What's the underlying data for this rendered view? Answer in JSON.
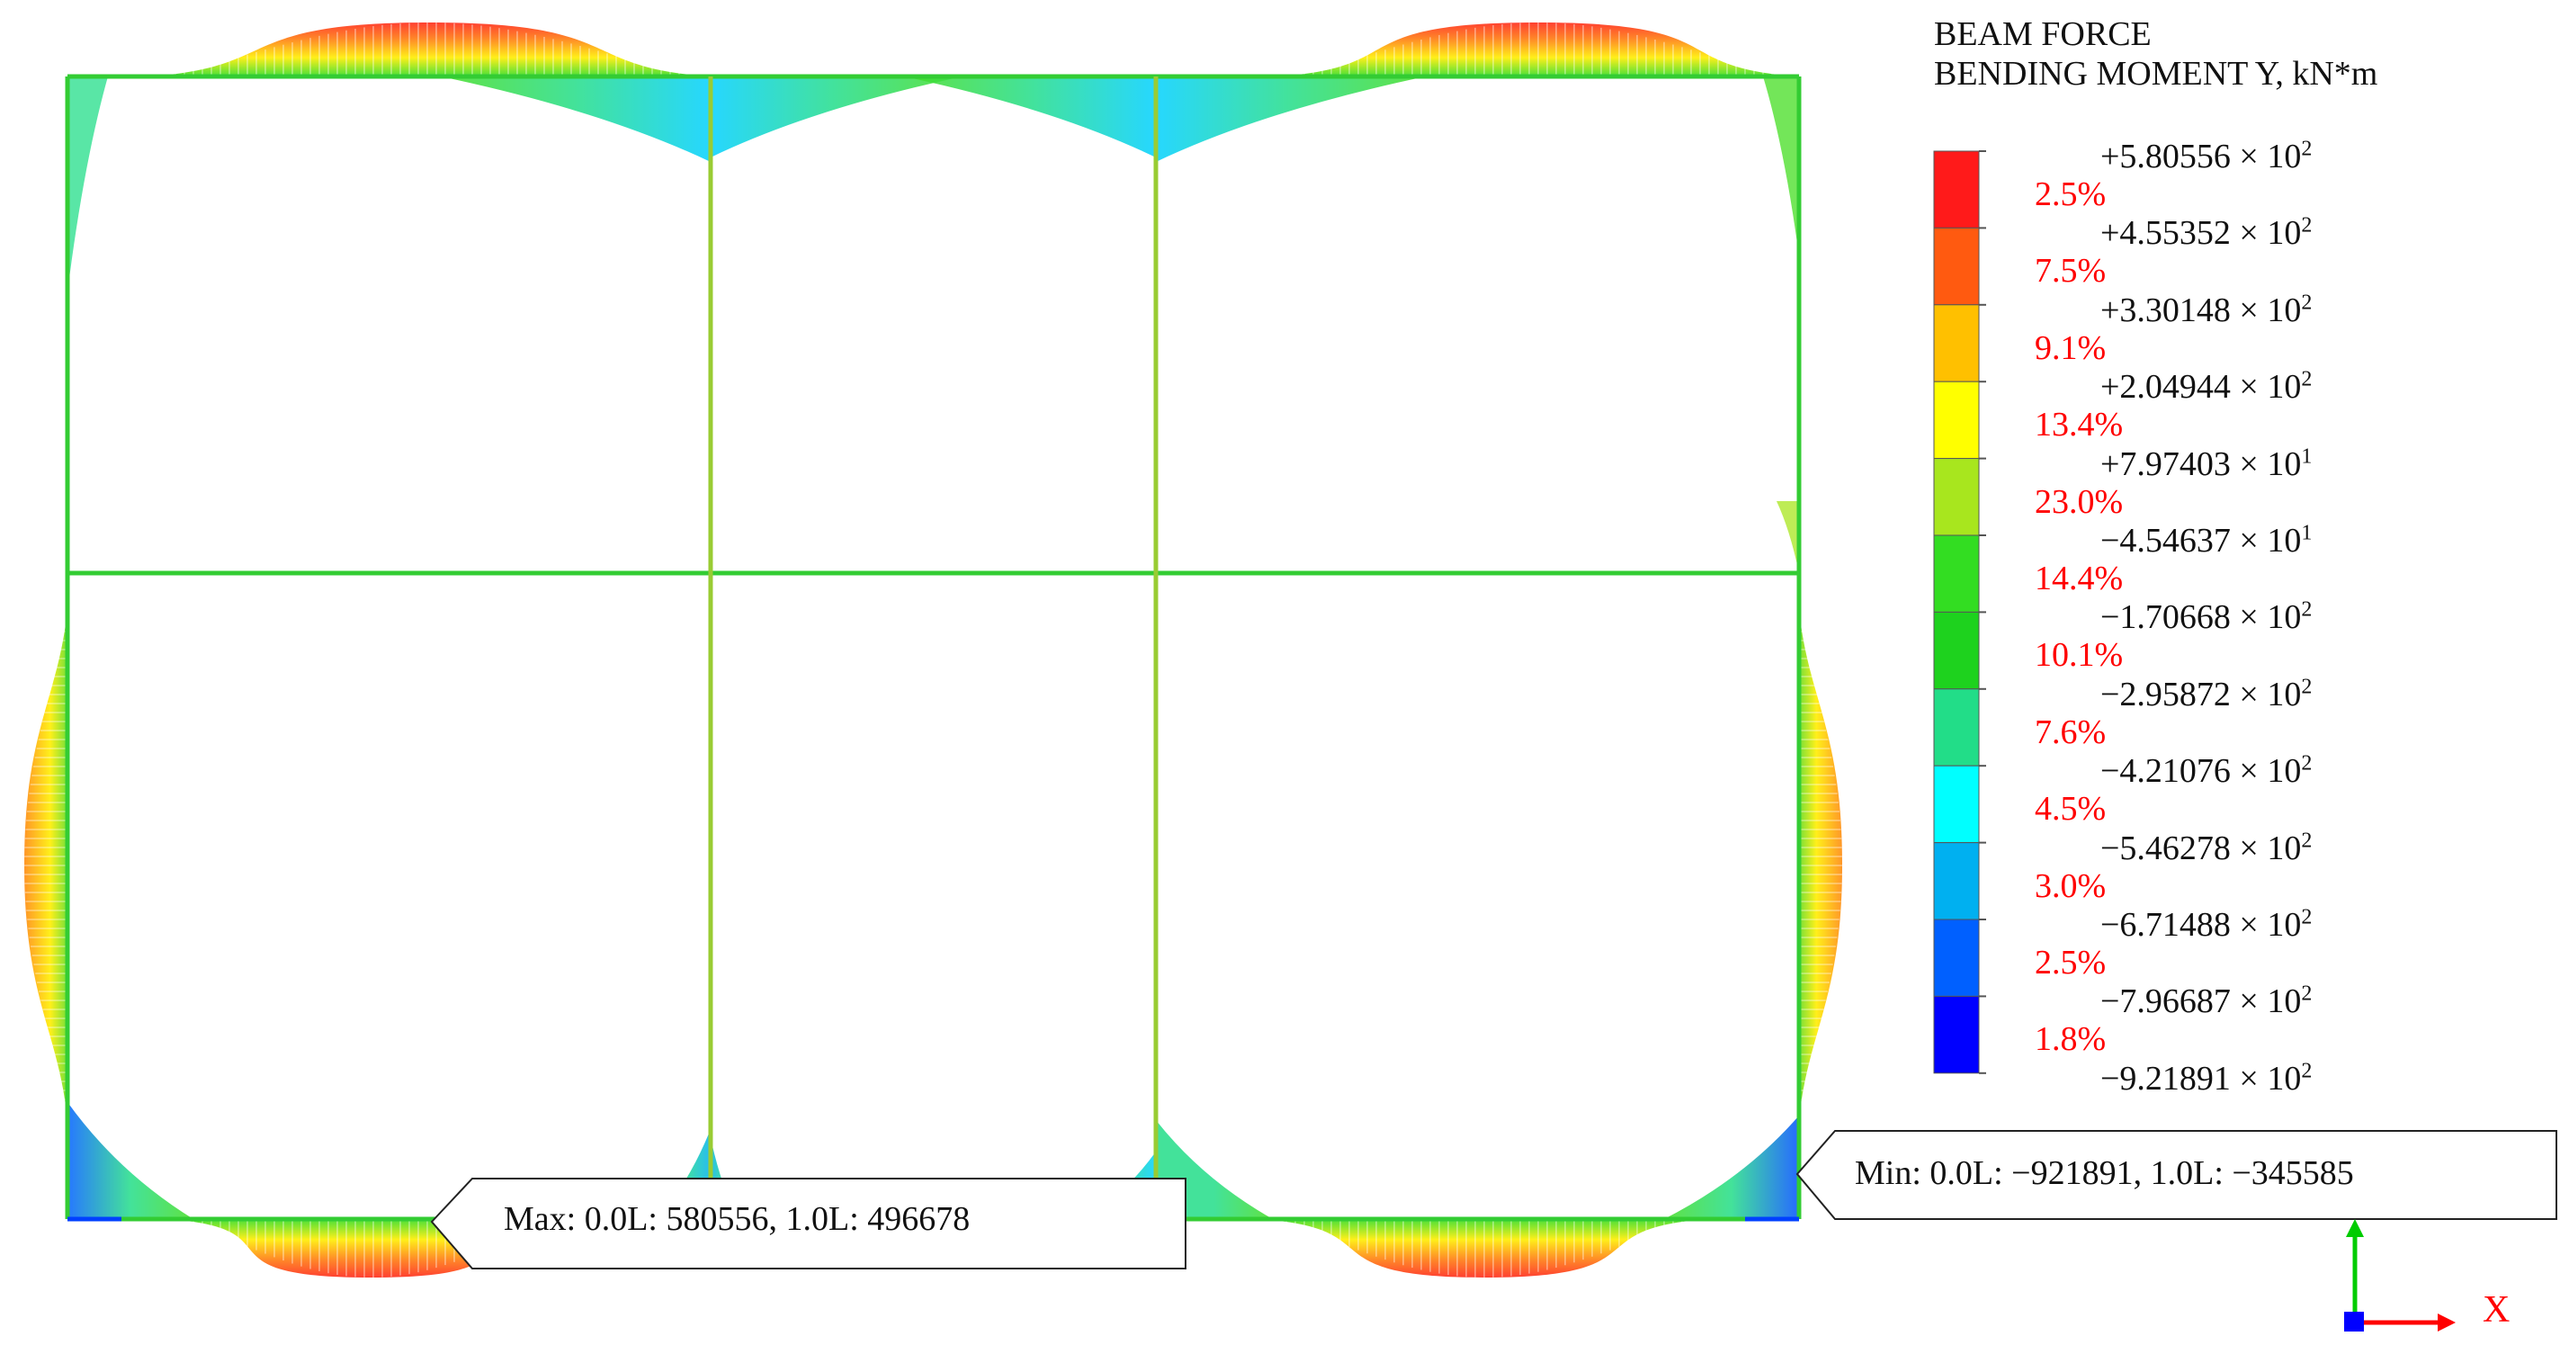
{
  "legend": {
    "title_line1": "BEAM FORCE",
    "title_line2": "BENDING MOMENT Y, kN*m",
    "levels": [
      {
        "mantissa": "+5.80556",
        "exp": "2",
        "color": "#ff1a1a"
      },
      {
        "mantissa": "+4.55352",
        "exp": "2",
        "color": "#ff5a10"
      },
      {
        "mantissa": "+3.30148",
        "exp": "2",
        "color": "#ffc000"
      },
      {
        "mantissa": "+2.04944",
        "exp": "2",
        "color": "#ffff00"
      },
      {
        "mantissa": "+7.97403",
        "exp": "1",
        "color": "#a8e61e"
      },
      {
        "mantissa": "−4.54637",
        "exp": "1",
        "color": "#33dd22"
      },
      {
        "mantissa": "−1.70668",
        "exp": "2",
        "color": "#1ed21e"
      },
      {
        "mantissa": "−2.95872",
        "exp": "2",
        "color": "#22dd88"
      },
      {
        "mantissa": "−4.21076",
        "exp": "2",
        "color": "#00ffff"
      },
      {
        "mantissa": "−5.46278",
        "exp": "2",
        "color": "#00b0f0"
      },
      {
        "mantissa": "−6.71488",
        "exp": "2",
        "color": "#0060ff"
      },
      {
        "mantissa": "−7.96687",
        "exp": "2",
        "color": "#0000ff"
      },
      {
        "mantissa": "−9.21891",
        "exp": "2",
        "color": ""
      }
    ],
    "percentages": [
      "2.5%",
      "7.5%",
      "9.1%",
      "13.4%",
      "23.0%",
      "14.4%",
      "10.1%",
      "7.6%",
      "4.5%",
      "3.0%",
      "2.5%",
      "1.8%"
    ],
    "times_symbol": "× 10",
    "percent_color": "#ff0000"
  },
  "callouts": {
    "max_text": "Max: 0.0L: 580556, 1.0L: 496678",
    "min_text": "Min: 0.0L: −921891, 1.0L: −345585"
  },
  "axes": {
    "x_label": "X",
    "x_color": "#ff0000",
    "z_color": "#00cc00",
    "origin_color": "#0000ff"
  },
  "frame": {
    "member_color": "#33cc33",
    "column_color": "#99cc33"
  }
}
